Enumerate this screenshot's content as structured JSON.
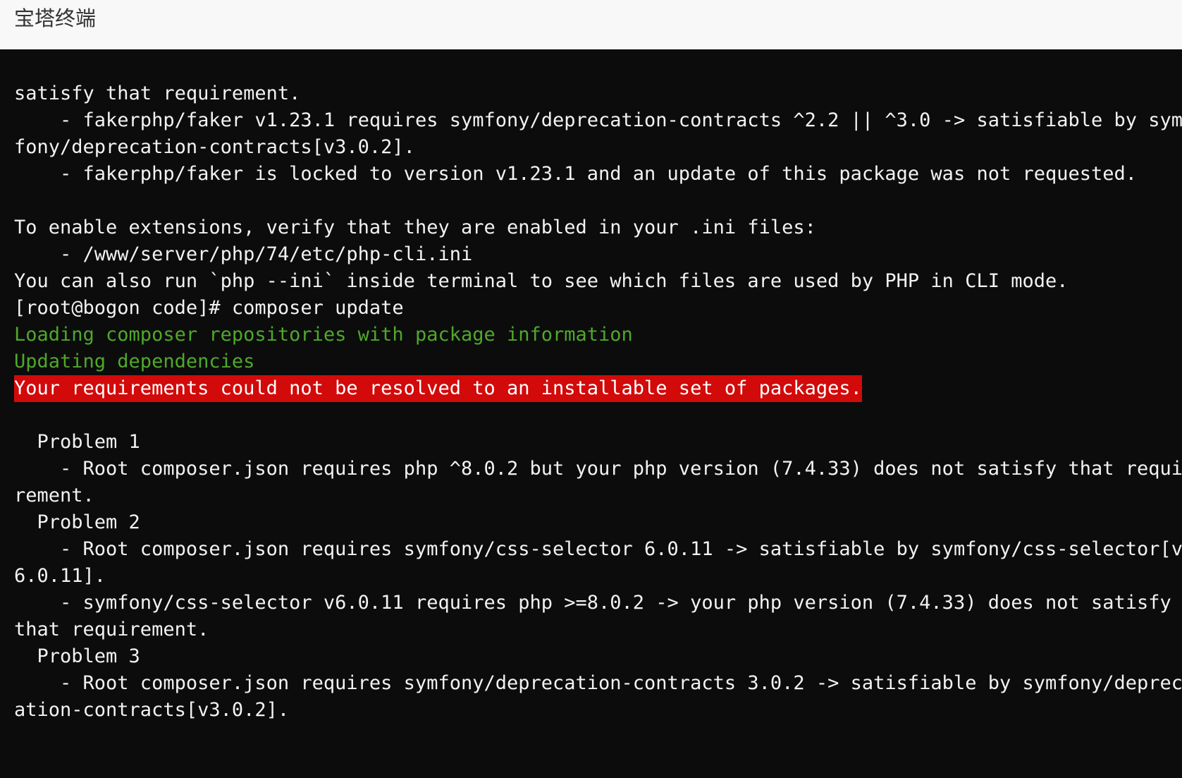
{
  "window": {
    "title": "宝塔终端"
  },
  "colors": {
    "titlebar_bg": "#f8f8f8",
    "terminal_bg": "#0c0c0c",
    "terminal_fg": "#f2f2f2",
    "info_green": "#4fa82b",
    "error_bg": "#d20a0a"
  },
  "terminal": {
    "lines": [
      {
        "text": "satisfy that requirement.",
        "style": "normal"
      },
      {
        "text": "    - fakerphp/faker v1.23.1 requires symfony/deprecation-contracts ^2.2 || ^3.0 -> satisfiable by sym",
        "style": "normal"
      },
      {
        "text": "fony/deprecation-contracts[v3.0.2].",
        "style": "normal"
      },
      {
        "text": "    - fakerphp/faker is locked to version v1.23.1 and an update of this package was not requested.",
        "style": "normal"
      },
      {
        "text": "",
        "style": "normal"
      },
      {
        "text": "To enable extensions, verify that they are enabled in your .ini files:",
        "style": "normal"
      },
      {
        "text": "    - /www/server/php/74/etc/php-cli.ini",
        "style": "normal"
      },
      {
        "text": "You can also run `php --ini` inside terminal to see which files are used by PHP in CLI mode.",
        "style": "normal"
      },
      {
        "text": "[root@bogon code]# composer update",
        "style": "normal"
      },
      {
        "text": "Loading composer repositories with package information",
        "style": "green"
      },
      {
        "text": "Updating dependencies",
        "style": "green"
      },
      {
        "text": "Your requirements could not be resolved to an installable set of packages.",
        "style": "error"
      },
      {
        "text": "",
        "style": "normal"
      },
      {
        "text": "  Problem 1",
        "style": "normal"
      },
      {
        "text": "    - Root composer.json requires php ^8.0.2 but your php version (7.4.33) does not satisfy that requi",
        "style": "normal"
      },
      {
        "text": "rement.",
        "style": "normal"
      },
      {
        "text": "  Problem 2",
        "style": "normal"
      },
      {
        "text": "    - Root composer.json requires symfony/css-selector 6.0.11 -> satisfiable by symfony/css-selector[v",
        "style": "normal"
      },
      {
        "text": "6.0.11].",
        "style": "normal"
      },
      {
        "text": "    - symfony/css-selector v6.0.11 requires php >=8.0.2 -> your php version (7.4.33) does not satisfy",
        "style": "normal"
      },
      {
        "text": "that requirement.",
        "style": "normal"
      },
      {
        "text": "  Problem 3",
        "style": "normal"
      },
      {
        "text": "    - Root composer.json requires symfony/deprecation-contracts 3.0.2 -> satisfiable by symfony/deprec",
        "style": "normal"
      },
      {
        "text": "ation-contracts[v3.0.2].",
        "style": "normal"
      }
    ]
  }
}
